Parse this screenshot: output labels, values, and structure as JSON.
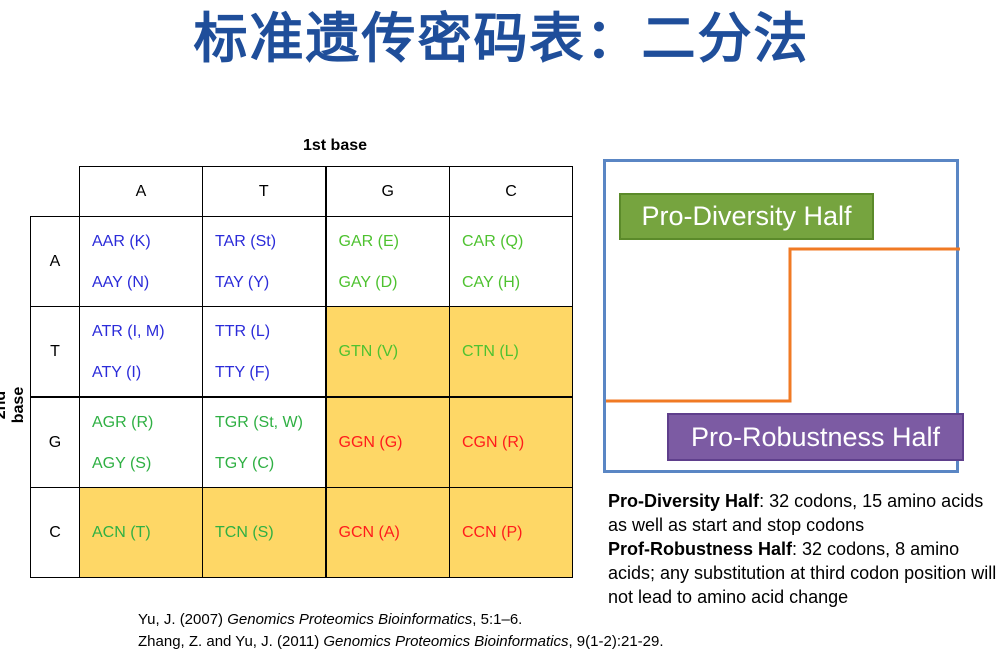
{
  "title": "标准遗传密码表：二分法",
  "table": {
    "first_base_label": "1st base",
    "second_base_label": "2nd base",
    "columns": [
      "A",
      "T",
      "G",
      "C"
    ],
    "rows": [
      {
        "label": "A",
        "cells": [
          {
            "lines": [
              "AAR (K)",
              "AAY (N)"
            ],
            "color": "#2b2bd9",
            "highlight": false
          },
          {
            "lines": [
              "TAR (St)",
              "TAY (Y)"
            ],
            "color": "#2b2bd9",
            "highlight": false
          },
          {
            "lines": [
              "GAR (E)",
              "GAY (D)"
            ],
            "color": "#4ec230",
            "highlight": false
          },
          {
            "lines": [
              "CAR (Q)",
              "CAY (H)"
            ],
            "color": "#4ec230",
            "highlight": false
          }
        ]
      },
      {
        "label": "T",
        "cells": [
          {
            "lines": [
              "ATR (I, M)",
              "ATY (I)"
            ],
            "color": "#2b2bd9",
            "highlight": false
          },
          {
            "lines": [
              "TTR (L)",
              "TTY (F)"
            ],
            "color": "#2b2bd9",
            "highlight": false
          },
          {
            "lines": [
              "GTN (V)"
            ],
            "color": "#4ec230",
            "highlight": true
          },
          {
            "lines": [
              "CTN (L)"
            ],
            "color": "#4ec230",
            "highlight": true
          }
        ]
      },
      {
        "label": "G",
        "cells": [
          {
            "lines": [
              "AGR (R)",
              "AGY (S)"
            ],
            "color": "#2fb043",
            "highlight": false
          },
          {
            "lines": [
              "TGR (St, W)",
              "TGY (C)"
            ],
            "color": "#2fb043",
            "highlight": false
          },
          {
            "lines": [
              "GGN (G)"
            ],
            "color": "#ff1b1b",
            "highlight": true
          },
          {
            "lines": [
              "CGN (R)"
            ],
            "color": "#ff1b1b",
            "highlight": true
          }
        ]
      },
      {
        "label": "C",
        "cells": [
          {
            "lines": [
              "ACN (T)"
            ],
            "color": "#2fb043",
            "highlight": true
          },
          {
            "lines": [
              "TCN (S)"
            ],
            "color": "#2fb043",
            "highlight": true
          },
          {
            "lines": [
              "GCN (A)"
            ],
            "color": "#ff1b1b",
            "highlight": true
          },
          {
            "lines": [
              "CCN (P)"
            ],
            "color": "#ff1b1b",
            "highlight": true
          }
        ]
      }
    ]
  },
  "diagram": {
    "pro_diversity_label": "Pro-Diversity Half",
    "pro_robustness_label": "Pro-Robustness Half"
  },
  "description": {
    "diversity_term": "Pro-Diversity Half",
    "diversity_text": ": 32 codons, 15 amino acids as well as start and stop codons",
    "robustness_term": "Prof-Robustness Half",
    "robustness_text": ": 32 codons, 8 amino acids; any substitution at third codon position will not lead to amino acid change"
  },
  "references": [
    {
      "authors": "Yu, J. (2007) ",
      "journal": "Genomics Proteomics Bioinformatics",
      "rest": ", 5:1–6."
    },
    {
      "authors": "Zhang, Z. and Yu, J. (2011) ",
      "journal": "Genomics Proteomics Bioinformatics",
      "rest": ", 9(1-2):21-29."
    }
  ],
  "colors": {
    "title": "#1f4e9a",
    "highlight": "#fed766",
    "panel_border": "#5a86c4",
    "diversity_box": "#76a43f",
    "robustness_box": "#7c5ba3",
    "step_line": "#f07a24"
  }
}
